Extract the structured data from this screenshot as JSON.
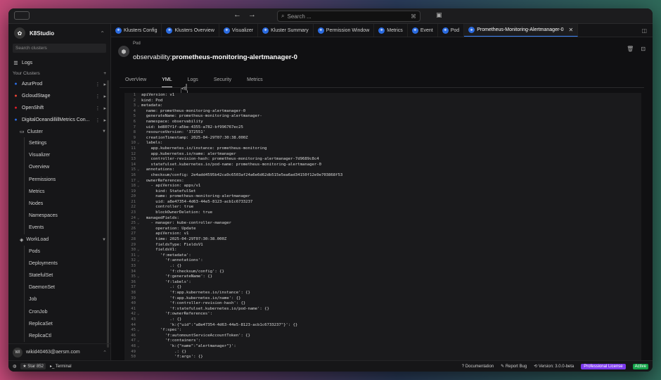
{
  "titlebar": {
    "back": "←",
    "forward": "→",
    "search_placeholder": "Search ...",
    "search_kbd": "⌘"
  },
  "sidebar": {
    "brand": "K8Studio",
    "search_placeholder": "Search clusters",
    "logs": "Logs",
    "your_clusters": "Your Clusters",
    "clusters": [
      {
        "name": "AzurProd",
        "color": "#2b6be0"
      },
      {
        "name": "GcloudStage",
        "color": "#ea4335"
      },
      {
        "name": "OpenShift",
        "color": "#e11d2a"
      },
      {
        "name": "DigitalOceandillillMetrics Con...",
        "color": "#2b6be0"
      }
    ],
    "cluster_group": "Cluster",
    "cluster_items": [
      "Settings",
      "Visualizer",
      "Overview",
      "Permissions",
      "Metrics",
      "Nodes",
      "Namespaces",
      "Events"
    ],
    "workload_group": "WorkLoad",
    "workload_items": [
      "Pods",
      "Deployments",
      "StatefulSet",
      "DaemonSet",
      "Job",
      "CronJob",
      "ReplicaSet",
      "ReplicaCtl"
    ],
    "user_initials": "WI",
    "user_email": "wikid40463@aersm.com"
  },
  "tabs": [
    {
      "label": "Klusters Config"
    },
    {
      "label": "Klusters Overview"
    },
    {
      "label": "Visualizer"
    },
    {
      "label": "Kluster Summary"
    },
    {
      "label": "Permission Window"
    },
    {
      "label": "Metrics"
    },
    {
      "label": "Event"
    },
    {
      "label": "Pod"
    },
    {
      "label": "Prometheus-Monitoring-Alertmanager-0"
    }
  ],
  "resource": {
    "kind": "Pod",
    "namespace": "observability:",
    "name": "prometheus-monitoring-alertmanager-0",
    "tabs": [
      "OverView",
      "YML",
      "Logs",
      "Security",
      "Metrics"
    ]
  },
  "yaml_lines": [
    "apiVersion: v1",
    "kind: Pod",
    "metadata:",
    "  name: prometheus-monitoring-alertmanager-0",
    "  generateName: prometheus-monitoring-alertmanager-",
    "  namespace: observability",
    "  uid: bd807f1f-a5be-4355-a782-bf996767ec25",
    "  resourceVersion: '372551'",
    "  creationTimestamp: 2025-04-29T07:30:38.000Z",
    "  labels:",
    "    app.kubernetes.io/instance: prometheus-monitoring",
    "    app.kubernetes.io/name: alertmanager",
    "    controller-revision-hash: prometheus-monitoring-alertmanager-7d9689c8c4",
    "    statefulset.kubernetes.io/pod-name: prometheus-monitoring-alertmanager-0",
    "  annotations:",
    "    checksum/config: 2e4add4595b42ca9c6503af24a6e6d62db515e5ea6ad34150f12e9e703868f53",
    "  ownerReferences:",
    "    - apiVersion: apps/v1",
    "      kind: StatefulSet",
    "      name: prometheus-monitoring-alertmanager",
    "      uid: a8e47354-4d63-44e5-8123-acb1c6733237",
    "      controller: true",
    "      blockOwnerDeletion: true",
    "  managedFields:",
    "    - manager: kube-controller-manager",
    "      operation: Update",
    "      apiVersion: v1",
    "      time: 2025-04-29T07:30:38.000Z",
    "      fieldsType: FieldsV1",
    "      fieldsV1:",
    "        'f:metadata':",
    "          'f:annotations':",
    "            .: {}",
    "            'f:checksum/config': {}",
    "          'f:generateName': {}",
    "          'f:labels':",
    "            .: {}",
    "            'f:app.kubernetes.io/instance': {}",
    "            'f:app.kubernetes.io/name': {}",
    "            'f:controller-revision-hash': {}",
    "            'f:statefulset.kubernetes.io/pod-name': {}",
    "          'f:ownerReferences':",
    "            .: {}",
    "            'k:{\"uid\":\"a8e47354-4d63-44e5-8123-acb1c6733237\"}': {}",
    "        'f:spec':",
    "          'f:automountServiceAccountToken': {}",
    "          'f:containers':",
    "            'k:{\"name\":\"alertmanager\"}':",
    "              .: {}",
    "              'f:args': {}",
    "              'f:env':"
  ],
  "statusbar": {
    "star": "Star",
    "star_count": "852",
    "terminal": "Terminal",
    "documentation": "Documentation",
    "report_bug": "Report Bug",
    "version": "Version: 3.0.0-beta",
    "license": "Professional License",
    "license_status": "Active"
  }
}
